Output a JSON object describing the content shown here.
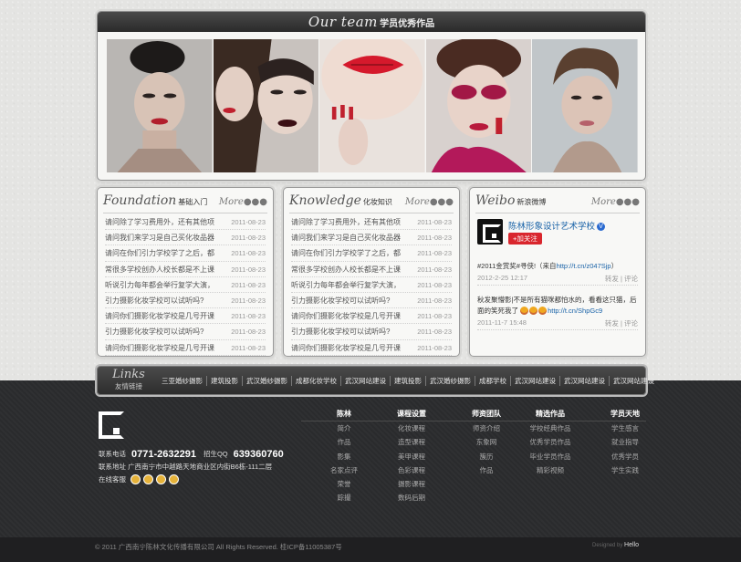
{
  "team": {
    "title_script": "Our team",
    "title_cn": "学员优秀作品",
    "photos": [
      "portrait-1",
      "portrait-2",
      "portrait-3",
      "portrait-4",
      "portrait-5"
    ]
  },
  "foundation": {
    "title_script": "Foundation",
    "title_cn": "基础入门",
    "more": "More",
    "items": [
      {
        "title": "请问除了学习费用外，还有其他项",
        "date": "2011-08-23"
      },
      {
        "title": "请问我们来学习是自己买化妆品器",
        "date": "2011-08-23"
      },
      {
        "title": "请问在你们引力学校学了之后，都",
        "date": "2011-08-23"
      },
      {
        "title": "常很多学校创办人校长都是不上课",
        "date": "2011-08-23"
      },
      {
        "title": "听说引力每年都会举行复学大演，",
        "date": "2011-08-23"
      },
      {
        "title": "引力摄影化妆学校可以试听吗?",
        "date": "2011-08-23"
      },
      {
        "title": "请问你们摄影化妆学校是几号开课",
        "date": "2011-08-23"
      },
      {
        "title": "引力摄影化妆学校可以试听吗?",
        "date": "2011-08-23"
      },
      {
        "title": "请问你们摄影化妆学校是几号开课",
        "date": "2011-08-23"
      }
    ]
  },
  "knowledge": {
    "title_script": "Knowledge",
    "title_cn": "化妆知识",
    "more": "More",
    "items": [
      {
        "title": "请问除了学习费用外，还有其他项",
        "date": "2011-08-23"
      },
      {
        "title": "请问我们来学习是自己买化妆品器",
        "date": "2011-08-23"
      },
      {
        "title": "请问在你们引力学校学了之后，都",
        "date": "2011-08-23"
      },
      {
        "title": "常很多学校创办人校长都是不上课",
        "date": "2011-08-23"
      },
      {
        "title": "听说引力每年都会举行复学大演，",
        "date": "2011-08-23"
      },
      {
        "title": "引力摄影化妆学校可以试听吗?",
        "date": "2011-08-23"
      },
      {
        "title": "请问你们摄影化妆学校是几号开课",
        "date": "2011-08-23"
      },
      {
        "title": "引力摄影化妆学校可以试听吗?",
        "date": "2011-08-23"
      },
      {
        "title": "请问你们摄影化妆学校是几号开课",
        "date": "2011-08-23"
      }
    ]
  },
  "weibo": {
    "title_script": "Weibo",
    "title_cn": "新浪微博",
    "more": "More",
    "account": "陈林形象设计艺术学校",
    "verified": "V",
    "follow": "+加关注",
    "posts": [
      {
        "text": "#2011金赏奖#寻侠!（来自",
        "link": "http://t.cn/z047Sjp",
        "text_after": "）",
        "time": "2012-2-25 12:17",
        "repost": "转发",
        "comment": "评论"
      },
      {
        "text": "秋发聚懵影|不是所有猫咪都怕水的，看看这只猫，后面的笑死我了",
        "link": "http://t.cn/ShpGc9",
        "time": "2011-11-7 15:48",
        "repost": "转发",
        "comment": "评论"
      }
    ]
  },
  "links": {
    "title_script": "Links",
    "title_cn": "友情链接",
    "items": [
      "三亚婚纱摄影",
      "建筑投影",
      "武汉婚纱摄影",
      "成都化妆学校",
      "武汉网站建设",
      "建筑投影",
      "武汉婚纱摄影",
      "成都学校",
      "武汉网站建设",
      "武汉网站建设",
      "武汉网站建设"
    ]
  },
  "footer": {
    "phone_label": "联系电话",
    "phone": "0771-2632291",
    "qq_label": "招生QQ",
    "qq": "639360760",
    "address_label": "联系地址",
    "address": "广西南宁市中越路天地商业区内街B6栋-111二层",
    "service_label": "在线客服",
    "columns": [
      {
        "head": "陈林",
        "items": [
          "简介",
          "作品",
          "影集",
          "名家点评",
          "荣誉",
          "踪撮"
        ]
      },
      {
        "head": "课程设置",
        "items": [
          "化妆课程",
          "造型课程",
          "美甲课程",
          "色彩课程",
          "摄影课程",
          "数码后期"
        ]
      },
      {
        "head": "师资团队",
        "items": [
          "师资介绍",
          "东象网",
          "簇历",
          "作品"
        ]
      },
      {
        "head": "精选作品",
        "items": [
          "学校经典作品",
          "优秀学员作品",
          "毕业学员作品",
          "精彩视频"
        ]
      },
      {
        "head": "学员天地",
        "items": [
          "学生感言",
          "就业指导",
          "优秀学员",
          "学生实践"
        ]
      }
    ],
    "copyright": "© 2011 广西南宁陈林文化传播有限公司 All Rights Reserved. 桂ICP备11005387号",
    "designed_by": "Designed by",
    "designer": "Hello"
  },
  "colors": {
    "accent_red": "#d9262d",
    "link_blue": "#1a63a8",
    "dark_bg": "#2a2b2d"
  }
}
